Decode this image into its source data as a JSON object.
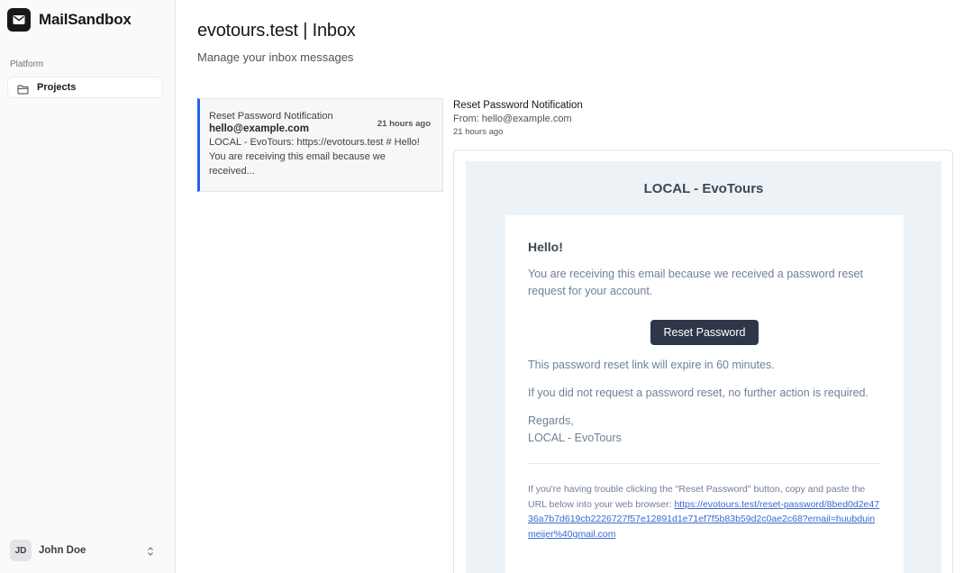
{
  "app": {
    "name": "MailSandbox"
  },
  "sidebar": {
    "group_label": "Platform",
    "items": [
      {
        "label": "Projects",
        "icon": "folder-icon"
      }
    ],
    "user": {
      "initials": "JD",
      "name": "John Doe"
    }
  },
  "page": {
    "title": "evotours.test | Inbox",
    "subtitle": "Manage your inbox messages"
  },
  "messages": [
    {
      "subject": "Reset Password Notification",
      "from": "hello@example.com",
      "time": "21 hours ago",
      "preview": "LOCAL - EvoTours: https://evotours.test # Hello! You are receiving this email because we received..."
    }
  ],
  "detail": {
    "subject": "Reset Password Notification",
    "from_line": "From: hello@example.com",
    "time": "21 hours ago"
  },
  "email": {
    "header": "LOCAL - EvoTours",
    "greeting": "Hello!",
    "intro": "You are receiving this email because we received a password reset request for your account.",
    "button_label": "Reset Password",
    "expire_text": "This password reset link will expire in 60 minutes.",
    "no_action_text": "If you did not request a password reset, no further action is required.",
    "regards": "Regards,",
    "signature": "LOCAL - EvoTours",
    "trouble_text": "If you're having trouble clicking the \"Reset Password\" button, copy and paste the URL below into your web browser: ",
    "reset_url": "https://evotours.test/reset-password/8bed0d2e4736a7b7d619cb2226727f57e12891d1e71ef7f5b83b59d2c0ae2c68?email=huubduinmeijer%40gmail.com"
  },
  "colors": {
    "accent": "#2563eb",
    "sidebar_bg": "#fafafa",
    "email_bg": "#edf2f7",
    "button_bg": "#2d3748",
    "link": "#3869d4"
  }
}
